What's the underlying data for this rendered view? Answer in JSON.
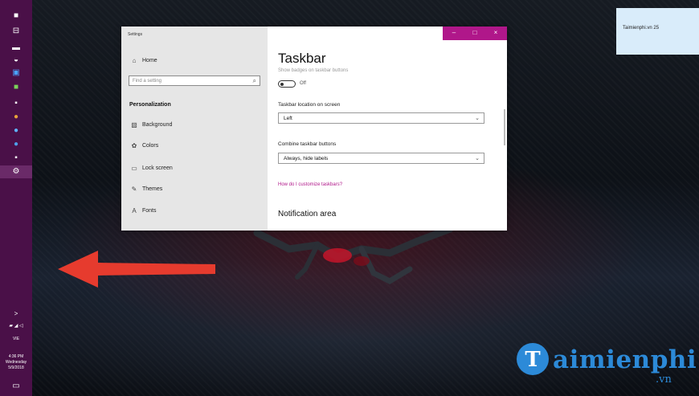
{
  "taskbar": {
    "icons": [
      "windows-icon",
      "task-view-icon",
      "folder-icon",
      "store-icon",
      "mail-icon",
      "app-icon",
      "photos-icon",
      "browser-icon",
      "chrome-icon",
      "edge-icon",
      "app-icon-2",
      "app-icon-3",
      "settings-icon"
    ],
    "tray_chevron": ">",
    "language": "VIE",
    "time": "4:36 PM",
    "day": "Wednesday",
    "date": "5/9/2018"
  },
  "notification": {
    "text": "Taimienphi.vn 25"
  },
  "settings": {
    "window_title": "Settings",
    "nav": {
      "home_label": "Home",
      "search_placeholder": "Find a setting",
      "section": "Personalization",
      "items": [
        "Background",
        "Colors",
        "Lock screen",
        "Themes",
        "Fonts"
      ]
    },
    "caption_buttons": {
      "minimize": "–",
      "maximize": "□",
      "close": "×"
    },
    "page_title": "Taskbar",
    "badges_label": "Show badges on taskbar buttons",
    "badges_state": "Off",
    "location_label": "Taskbar location on screen",
    "location_value": "Left",
    "combine_label": "Combine taskbar buttons",
    "combine_value": "Always, hide labels",
    "customize_link": "How do I customize taskbars?",
    "notification_area": "Notification area"
  },
  "watermark": {
    "brand": "aimienphi",
    "initial": "T",
    "suffix": ".vn"
  },
  "colors": {
    "taskbar": "#4a1048",
    "accent": "#b0178a",
    "arrow": "#e63b2e",
    "logo": "#2c8ad8"
  }
}
